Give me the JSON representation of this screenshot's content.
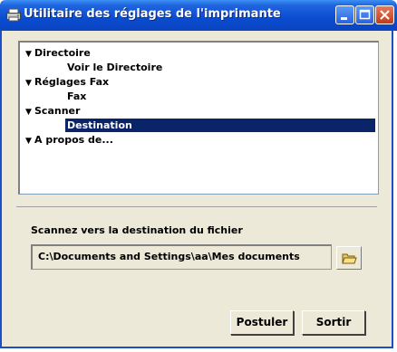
{
  "window": {
    "title": "Utilitaire des réglages de l'imprimante",
    "icons": {
      "app": "printer-icon",
      "minimize": "minimize-icon",
      "maximize": "maximize-icon",
      "close": "close-icon"
    }
  },
  "tree": {
    "items": [
      {
        "label": "Directoire",
        "level": 0,
        "expanded": true
      },
      {
        "label": "Voir le Directoire",
        "level": 1
      },
      {
        "label": "Réglages Fax",
        "level": 0,
        "expanded": true
      },
      {
        "label": "Fax",
        "level": 1
      },
      {
        "label": "Scanner",
        "level": 0,
        "expanded": true
      },
      {
        "label": "Destination",
        "level": 1,
        "selected": true
      },
      {
        "label": "A propos de...",
        "level": 0,
        "expanded": true
      }
    ]
  },
  "scan": {
    "label": "Scannez vers la destination du fichier",
    "path": "C:\\Documents and Settings\\aa\\Mes documents",
    "browse_icon": "open-folder-icon"
  },
  "buttons": {
    "apply": "Postuler",
    "exit": "Sortir"
  },
  "colors": {
    "titlebar": "#0a4cd0",
    "selection": "#0a246a",
    "face": "#ece9d8"
  }
}
